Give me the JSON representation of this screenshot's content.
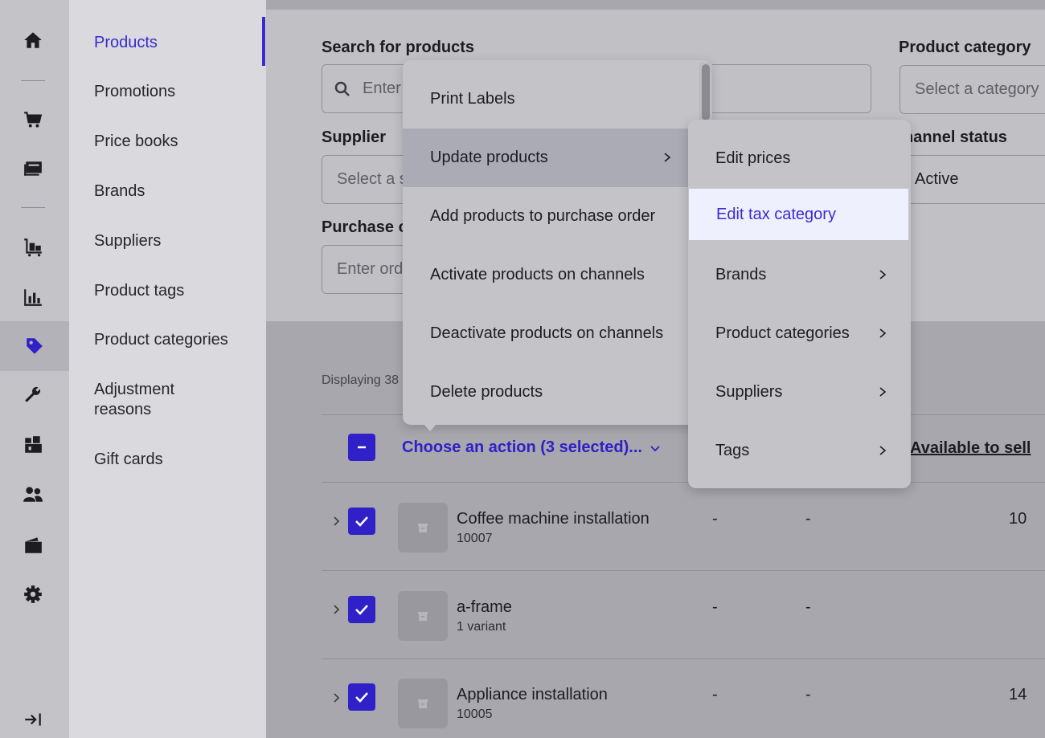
{
  "colors": {
    "accent": "#3a2bd0",
    "highlight_bg": "#eff0fe"
  },
  "rail": {
    "icons": [
      "home-icon",
      "cart-icon",
      "register-icon",
      "fulfilment-icon",
      "reports-icon",
      "tag-icon",
      "wrench-icon",
      "warehouse-icon",
      "customers-icon",
      "wallet-icon",
      "gear-icon",
      "collapse-icon"
    ],
    "active": "tag-icon"
  },
  "subnav": {
    "items": [
      {
        "label": "Products",
        "active": true
      },
      {
        "label": "Promotions"
      },
      {
        "label": "Price books"
      },
      {
        "label": "Brands"
      },
      {
        "label": "Suppliers"
      },
      {
        "label": "Product tags"
      },
      {
        "label": "Product categories"
      },
      {
        "label": "Adjustment reasons"
      },
      {
        "label": "Gift cards"
      }
    ]
  },
  "filters": {
    "search_label": "Search for products",
    "search_placeholder": "Enter",
    "category_label": "Product category",
    "category_placeholder": "Select a category",
    "supplier_label": "Supplier",
    "supplier_placeholder": "Select a s",
    "channel_label": "hannel status",
    "channel_value": "Active",
    "purchase_label": "Purchase o",
    "purchase_placeholder": "Enter ord"
  },
  "results": {
    "displaying": "Displaying 38",
    "action_link": "Choose an action (3 selected)...",
    "column_available": "Available to sell",
    "rows": [
      {
        "name": "Coffee machine installation",
        "sub": "10007",
        "col1": "-",
        "col2": "-",
        "available": "10"
      },
      {
        "name": "a-frame",
        "sub": "1 variant",
        "col1": "-",
        "col2": "-",
        "available": ""
      },
      {
        "name": "Appliance installation",
        "sub": "10005",
        "col1": "-",
        "col2": "-",
        "available": "14"
      }
    ]
  },
  "menu": {
    "items": [
      {
        "label": "Print Labels"
      },
      {
        "label": "Update products",
        "submenu": true
      },
      {
        "label": "Add products to purchase order"
      },
      {
        "label": "Activate products on channels"
      },
      {
        "label": "Deactivate products on channels"
      },
      {
        "label": "Delete products"
      }
    ]
  },
  "submenu": {
    "items": [
      {
        "label": "Edit prices"
      },
      {
        "label": "Edit tax category",
        "highlighted": true
      },
      {
        "label": "Brands",
        "submenu": true
      },
      {
        "label": "Product categories",
        "submenu": true
      },
      {
        "label": "Suppliers",
        "submenu": true
      },
      {
        "label": "Tags",
        "submenu": true
      }
    ]
  }
}
